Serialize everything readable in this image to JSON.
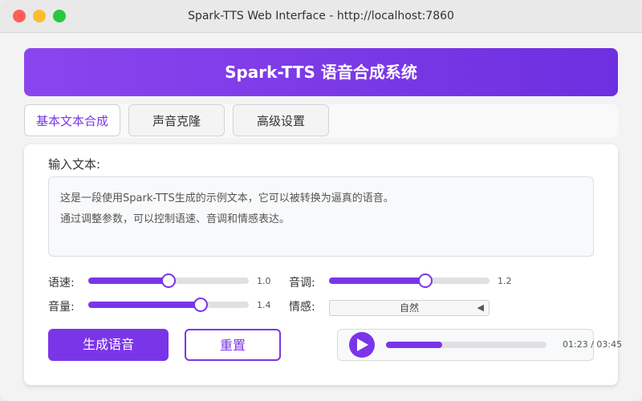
{
  "window": {
    "title": "Spark-TTS Web Interface - http://localhost:7860"
  },
  "header": {
    "title": "Spark-TTS 语音合成系统"
  },
  "tabs": [
    {
      "label": "基本文本合成",
      "active": true
    },
    {
      "label": "声音克隆",
      "active": false
    },
    {
      "label": "高级设置",
      "active": false
    }
  ],
  "form": {
    "input_label": "输入文本:",
    "text_lines": [
      "这是一段使用Spark-TTS生成的示例文本，它可以被转换为逼真的语音。",
      "通过调整参数，可以控制语速、音调和情感表达。"
    ],
    "sliders": {
      "speed": {
        "label": "语速:",
        "value": "1.0",
        "fraction": 0.5
      },
      "pitch": {
        "label": "音调:",
        "value": "1.2",
        "fraction": 0.6
      },
      "volume": {
        "label": "音量:",
        "value": "1.4",
        "fraction": 0.7
      }
    },
    "emotion": {
      "label": "情感:",
      "selected": "自然"
    },
    "buttons": {
      "generate": "生成语音",
      "reset": "重置"
    }
  },
  "player": {
    "time": "01:23 / 03:45",
    "progress": 0.35
  },
  "colors": {
    "accent": "#7b35e8",
    "header_start": "#8b45ee",
    "header_end": "#6d2fe0"
  },
  "icons": {
    "play": "play-icon",
    "dropdown": "caret-left-icon"
  }
}
